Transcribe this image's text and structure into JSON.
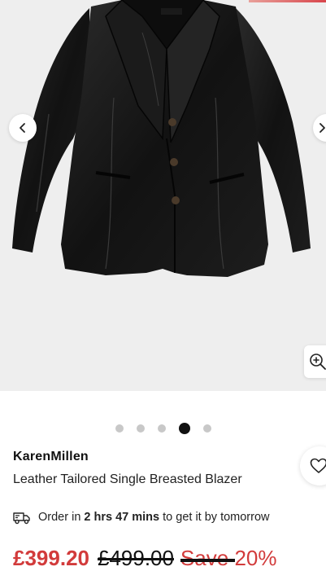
{
  "gallery": {
    "image_alt": "Black leather tailored single breasted blazer",
    "prev_icon": "chevron-left-icon",
    "next_icon": "chevron-right-icon",
    "zoom_icon": "zoom-in-icon",
    "dots_total": 5,
    "active_dot_index": 3
  },
  "product": {
    "brand": "KarenMillen",
    "name": "Leather Tailored Single Breasted Blazer",
    "wishlist_icon": "heart-icon"
  },
  "delivery": {
    "icon": "truck-icon",
    "prefix": "Order in ",
    "countdown": "2 hrs 47 mins",
    "suffix": " to get it by tomorrow"
  },
  "pricing": {
    "current": "£399.20",
    "original": "£499.00",
    "save": "Save 20%"
  },
  "colors": {
    "sale_red": "#d23b3b",
    "text_dark": "#111111",
    "gallery_bg": "#eeeeee"
  }
}
